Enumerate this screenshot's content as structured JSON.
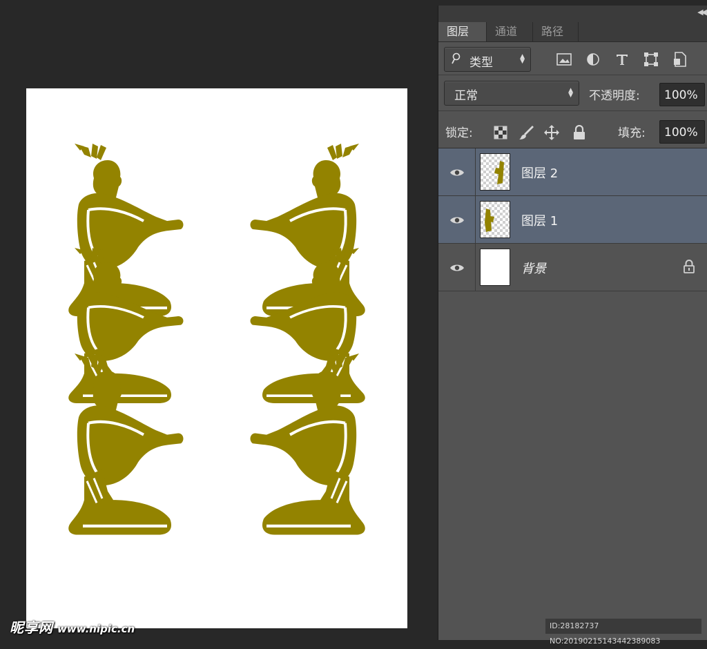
{
  "panel": {
    "tabs": [
      {
        "label": "图层",
        "active": true
      },
      {
        "label": "通道",
        "active": false
      },
      {
        "label": "路径",
        "active": false
      }
    ],
    "filter": {
      "label": "类型"
    },
    "filter_icons": [
      "image-filter-icon",
      "adjustment-filter-icon",
      "type-filter-icon",
      "shape-filter-icon",
      "smart-object-filter-icon"
    ],
    "blend_mode": "正常",
    "opacity_label": "不透明度:",
    "opacity_value": "100%",
    "lock_label": "锁定:",
    "lock_icons": [
      "lock-transparent-icon",
      "lock-brush-icon",
      "lock-move-icon",
      "lock-all-icon"
    ],
    "fill_label": "填充:",
    "fill_value": "100%",
    "layers": [
      {
        "name": "图层 2",
        "selected": true,
        "visible": true,
        "thumb": "transparent-art"
      },
      {
        "name": "图层 1",
        "selected": true,
        "visible": true,
        "thumb": "transparent-art"
      },
      {
        "name": "背景",
        "selected": false,
        "visible": true,
        "thumb": "white",
        "locked": true
      }
    ]
  },
  "watermark": {
    "brand": "昵享网",
    "url": "www.nipic.cn"
  },
  "image_id": "ID:28182737 NO:20190215143442389083",
  "colors": {
    "art": "#938300",
    "panel": "#535353",
    "selected_layer": "#5b6677",
    "workspace": "#282828"
  }
}
